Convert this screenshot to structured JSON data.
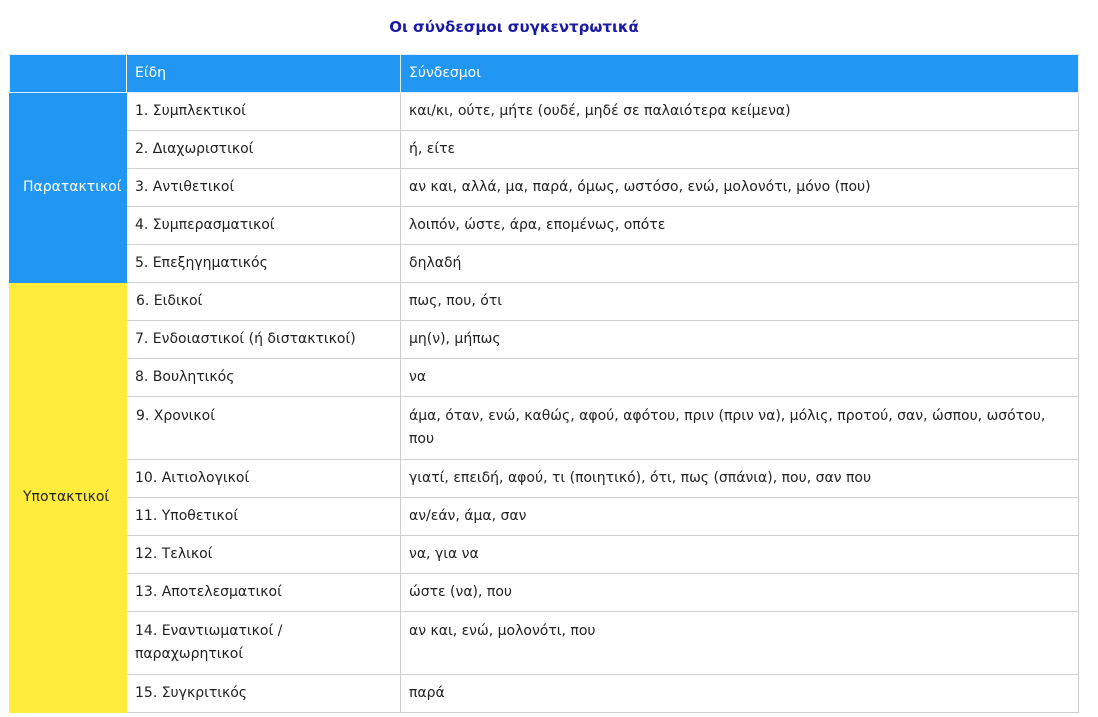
{
  "title": "Οι σύνδεσμοι συγκεντρωτικά",
  "table": {
    "headers": [
      "",
      "Είδη",
      "Σύνδεσμοι"
    ],
    "groups": [
      {
        "label": "Παρατακτικοί",
        "rows": [
          {
            "kind": "1. Συμπλεκτικοί",
            "values": "και/κι, ούτε, μήτε (ουδέ, μηδέ σε παλαιότερα κείμενα)"
          },
          {
            "kind": "2. Διαχωριστικοί",
            "values": "ή, είτε"
          },
          {
            "kind": "3. Αντιθετικοί",
            "values": "αν και, αλλά, μα, παρά, όμως, ωστόσο, ενώ, μολονότι, μόνο (που)"
          },
          {
            "kind": "4. Συμπερασματικοί",
            "values": "λοιπόν, ώστε, άρα, επομένως, οπότε"
          },
          {
            "kind": "5. Επεξηγηματικός",
            "values": "δηλαδή"
          }
        ]
      },
      {
        "label": "Υποτακτικοί",
        "rows": [
          {
            "kind": "6. Ειδικοί",
            "values": "πως, που, ότι"
          },
          {
            "kind": "7. Ενδοιαστικοί (ή διστακτικοί)",
            "values": "μη(ν), μήπως"
          },
          {
            "kind": "8. Βουλητικός",
            "values": "να"
          },
          {
            "kind": "9. Χρονικοί",
            "values": "άμα, όταν, ενώ, καθώς, αφού, αφότου, πριν (πριν να), μόλις, προτού, σαν, ώσπου, ωσότου, που"
          },
          {
            "kind": "10. Αιτιολογικοί",
            "values": "γιατί, επειδή, αφού, τι (ποιητικό), ότι, πως (σπάνια), που, σαν που"
          },
          {
            "kind": "11. Υποθετικοί",
            "values": "αν/εάν, άμα, σαν"
          },
          {
            "kind": "12. Τελικοί",
            "values": "να, για να"
          },
          {
            "kind": "13. Αποτελεσματικοί",
            "values": "ώστε (να), που"
          },
          {
            "kind": "14. Εναντιωματικοί / παραχωρητικοί",
            "values": "αν και, ενώ, μολονότι, που"
          },
          {
            "kind": "15. Συγκριτικός",
            "values": "παρά"
          }
        ]
      }
    ]
  },
  "colors": {
    "title": "#1a1aa6",
    "header": "#2196f3",
    "parataktikoi": "#2196f3",
    "ypotaktikoi": "#ffeb3b"
  }
}
